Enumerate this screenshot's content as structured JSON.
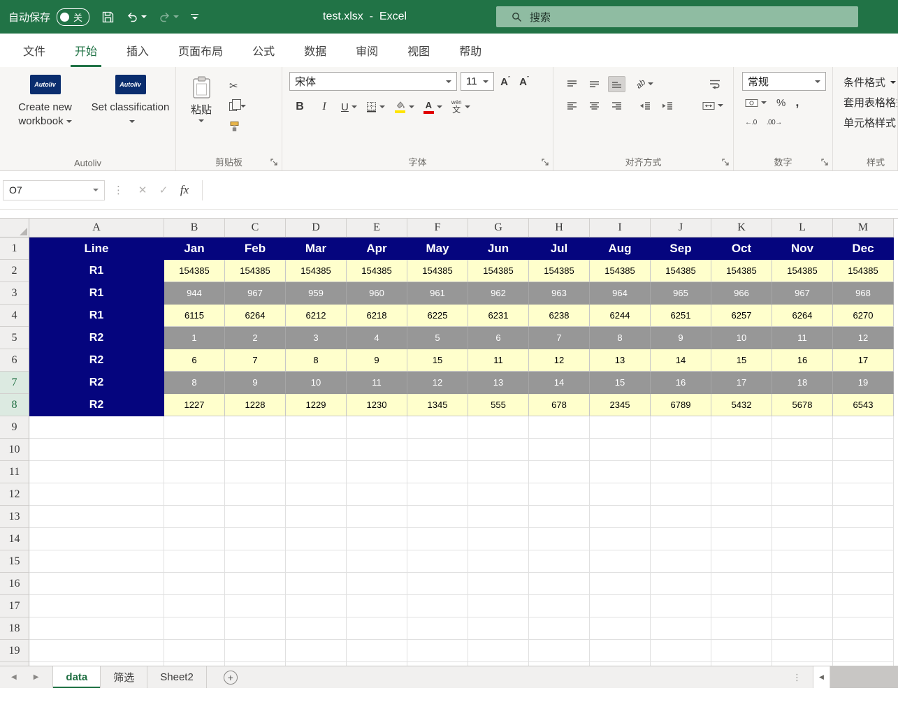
{
  "titlebar": {
    "autosave_label": "自动保存",
    "autosave_state": "关",
    "window_title": "test.xlsx  -  Excel",
    "search_label": "搜索"
  },
  "ribbon_tabs": {
    "items": [
      {
        "label": "文件",
        "active": false
      },
      {
        "label": "开始",
        "active": true
      },
      {
        "label": "插入",
        "active": false
      },
      {
        "label": "页面布局",
        "active": false
      },
      {
        "label": "公式",
        "active": false
      },
      {
        "label": "数据",
        "active": false
      },
      {
        "label": "审阅",
        "active": false
      },
      {
        "label": "视图",
        "active": false
      },
      {
        "label": "帮助",
        "active": false
      }
    ]
  },
  "ribbon": {
    "autoliv_group": {
      "label": "Autoliv",
      "logo_text": "Autoliv",
      "create_button": "Create new workbook",
      "classify_button": "Set classification"
    },
    "clipboard_group": {
      "label": "剪贴板",
      "paste_label": "粘贴"
    },
    "font_group": {
      "label": "字体",
      "font_name": "宋体",
      "font_size": "11",
      "bold": "B",
      "italic": "I",
      "underline": "U",
      "phonetic_top": "wén",
      "phonetic_bottom": "文"
    },
    "alignment_group": {
      "label": "对齐方式"
    },
    "number_group": {
      "label": "数字",
      "format": "常规",
      "percent": "%",
      "comma": ","
    },
    "styles_group": {
      "label": "样式",
      "buttons": [
        "条件格式",
        "套用表格格式",
        "单元格样式"
      ]
    }
  },
  "formula_bar": {
    "name_box": "O7",
    "fx_label": "fx",
    "formula_value": ""
  },
  "grid": {
    "columns": [
      "A",
      "B",
      "C",
      "D",
      "E",
      "F",
      "G",
      "H",
      "I",
      "J",
      "K",
      "L",
      "M"
    ],
    "total_rows": 20,
    "highlighted_row_headers": [
      7,
      8
    ],
    "header_row": [
      "Line",
      "Jan",
      "Feb",
      "Mar",
      "Apr",
      "May",
      "Jun",
      "Jul",
      "Aug",
      "Sep",
      "Oct",
      "Nov",
      "Dec"
    ],
    "data_rows": [
      {
        "line": "R1",
        "style": "yellow",
        "values": [
          154385,
          154385,
          154385,
          154385,
          154385,
          154385,
          154385,
          154385,
          154385,
          154385,
          154385,
          154385
        ]
      },
      {
        "line": "R1",
        "style": "gray",
        "values": [
          944,
          967,
          959,
          960,
          961,
          962,
          963,
          964,
          965,
          966,
          967,
          968
        ]
      },
      {
        "line": "R1",
        "style": "yellow",
        "values": [
          6115,
          6264,
          6212,
          6218,
          6225,
          6231,
          6238,
          6244,
          6251,
          6257,
          6264,
          6270
        ]
      },
      {
        "line": "R2",
        "style": "gray",
        "values": [
          1,
          2,
          3,
          4,
          5,
          6,
          7,
          8,
          9,
          10,
          11,
          12
        ]
      },
      {
        "line": "R2",
        "style": "yellow",
        "values": [
          6,
          7,
          8,
          9,
          15,
          11,
          12,
          13,
          14,
          15,
          16,
          17
        ]
      },
      {
        "line": "R2",
        "style": "gray",
        "values": [
          8,
          9,
          10,
          11,
          12,
          13,
          14,
          15,
          16,
          17,
          18,
          19
        ]
      },
      {
        "line": "R2",
        "style": "yellow",
        "values": [
          1227,
          1228,
          1229,
          1230,
          1345,
          555,
          678,
          2345,
          6789,
          5432,
          5678,
          6543
        ]
      }
    ]
  },
  "sheet_bar": {
    "tabs": [
      {
        "label": "data",
        "active": true
      },
      {
        "label": "筛选",
        "active": false
      },
      {
        "label": "Sheet2",
        "active": false
      }
    ]
  },
  "colors": {
    "titlebar_green": "#217346",
    "accent_green": "#217346",
    "header_navy": "#05057E",
    "row_yellow": "#FFFFCC",
    "row_gray": "#979797"
  }
}
